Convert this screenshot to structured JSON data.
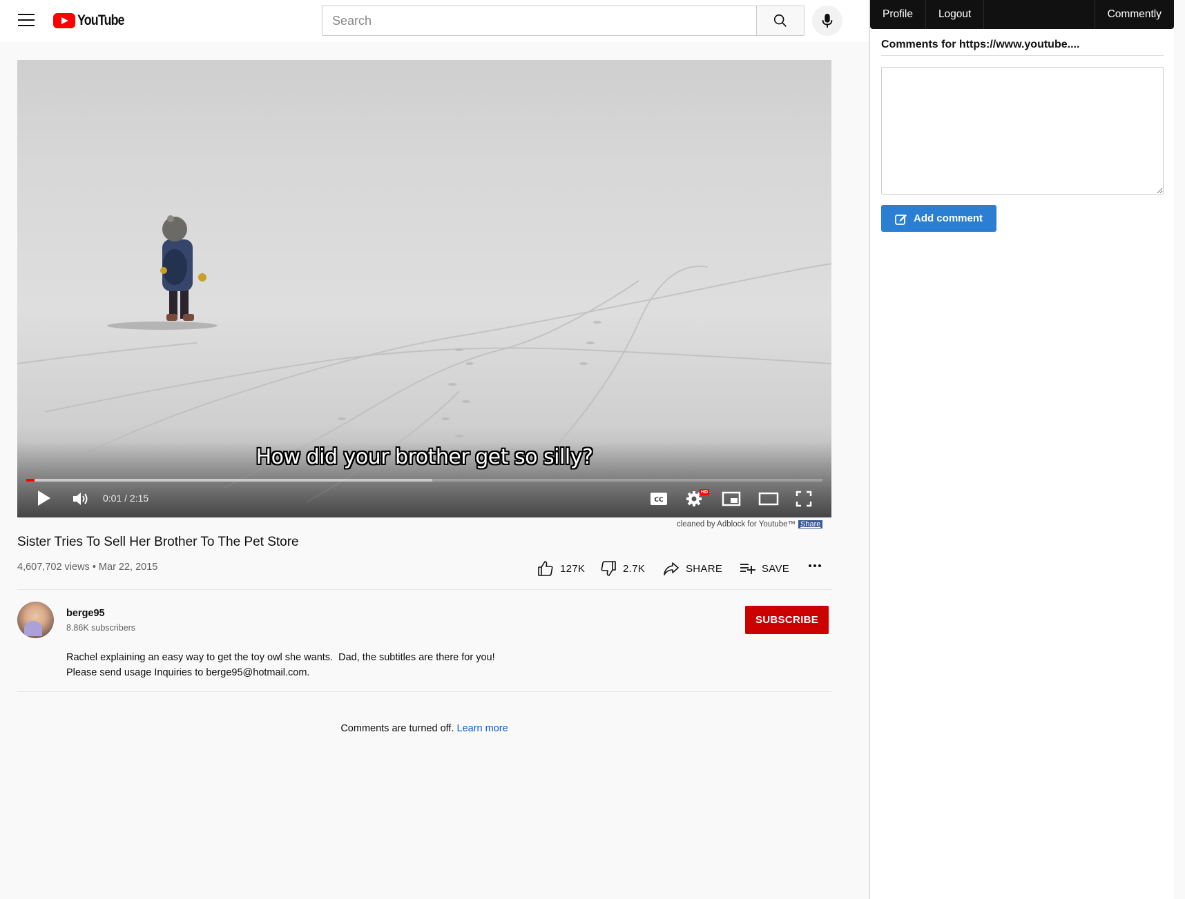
{
  "header": {
    "logo_text": "YouTube",
    "search_placeholder": "Search"
  },
  "player": {
    "caption": "How did your brother get so silly?",
    "time_display": "0:01 / 2:15",
    "progress_played_fraction": 0.01,
    "progress_buffered_fraction": 0.51,
    "hd_badge": "HD"
  },
  "adblock": {
    "text": "cleaned by Adblock for Youtube™",
    "share_label": "Share"
  },
  "video": {
    "title": "Sister Tries To Sell Her Brother To The Pet Store",
    "views_date": "4,607,702 views • Mar 22, 2015"
  },
  "actions": {
    "like_count": "127K",
    "dislike_count": "2.7K",
    "share_label": "SHARE",
    "save_label": "SAVE"
  },
  "channel": {
    "name": "berge95",
    "subscribers": "8.86K subscribers",
    "subscribe_label": "SUBSCRIBE"
  },
  "description": {
    "line1": "Rachel explaining an easy way to get the toy owl she wants.  Dad, the subtitles are there for you!",
    "line2": "Please send usage Inquiries to berge95@hotmail.com."
  },
  "comments": {
    "off_text": "Comments are turned off.",
    "learn_more": "Learn more"
  },
  "commently": {
    "nav_profile": "Profile",
    "nav_logout": "Logout",
    "nav_brand": "Commently",
    "heading": "Comments for https://www.youtube....",
    "comment_value": "",
    "add_comment_label": "Add comment"
  },
  "colors": {
    "brand_red": "#ff0000",
    "subscribe_red": "#cc0000",
    "link_blue": "#065fd4",
    "add_comment_blue": "#2b7fd2",
    "panel_nav": "#111111"
  }
}
